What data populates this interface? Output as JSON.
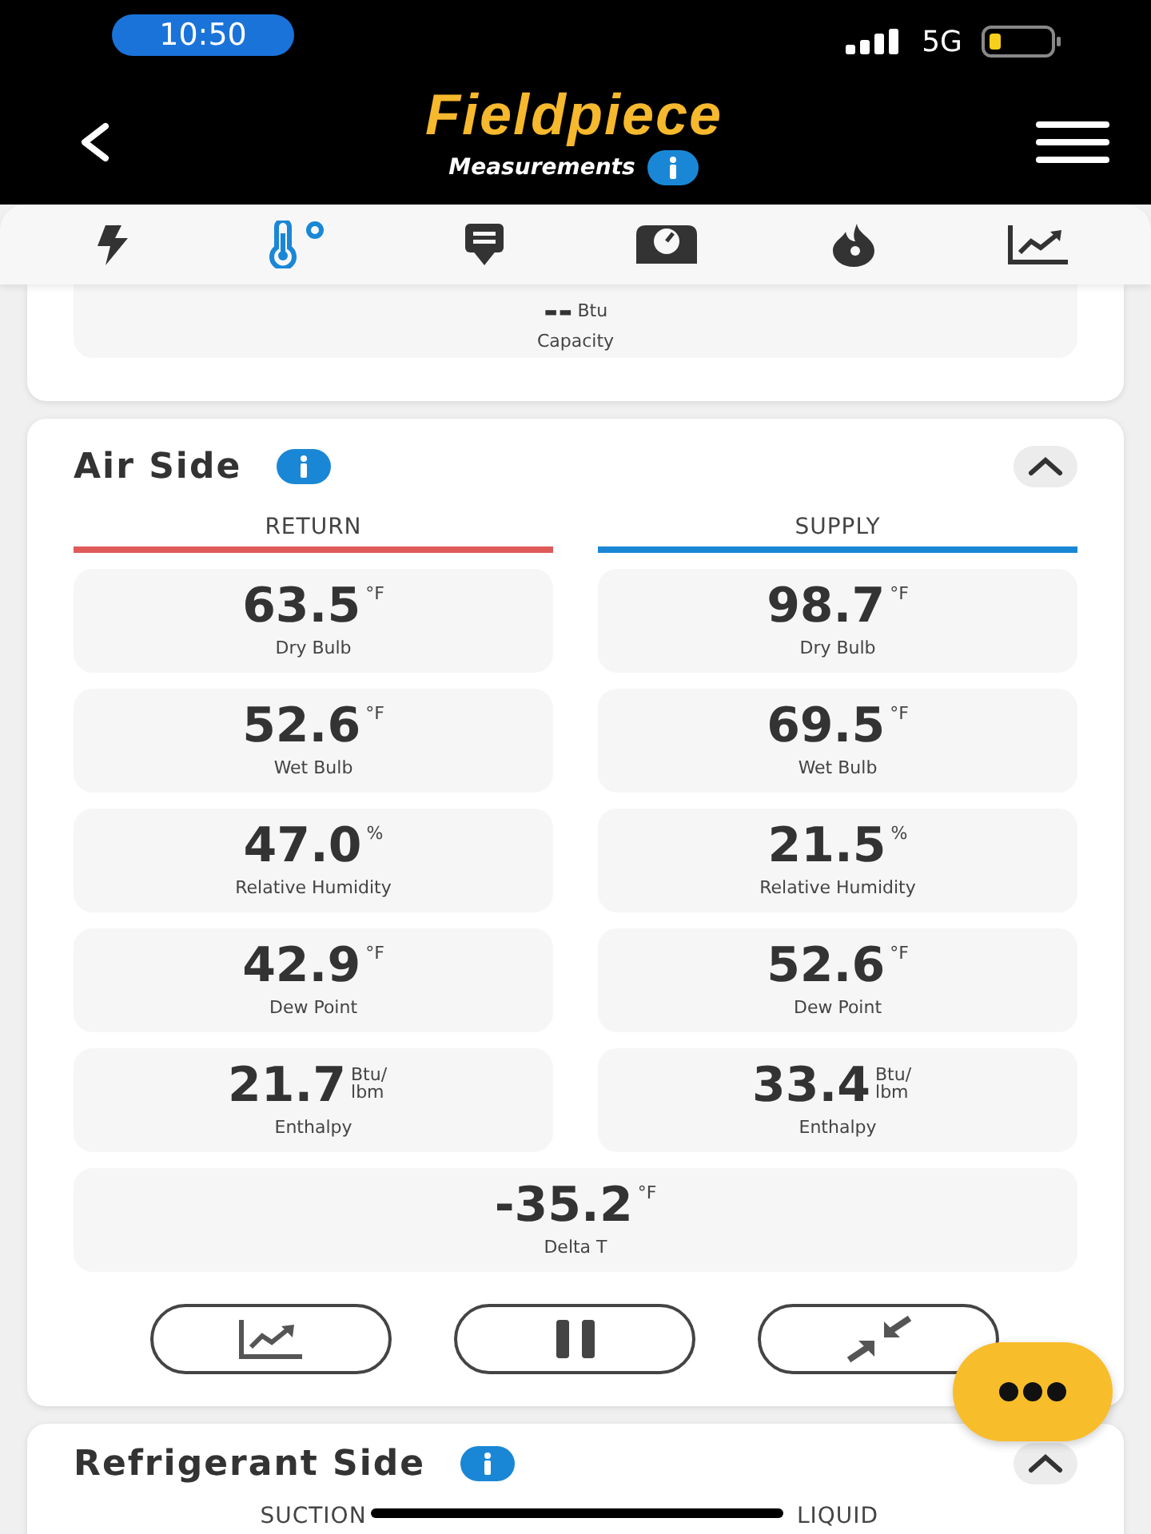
{
  "status_bar": {
    "time": "10:50",
    "network": "5G"
  },
  "header": {
    "title": "Fieldpiece",
    "subtitle": "Measurements"
  },
  "tabs": [
    {
      "kind": "power",
      "selected": false
    },
    {
      "kind": "temperature",
      "selected": true
    },
    {
      "kind": "download",
      "selected": false
    },
    {
      "kind": "scale",
      "selected": false
    },
    {
      "kind": "flame",
      "selected": false
    },
    {
      "kind": "chart",
      "selected": false
    }
  ],
  "capacity": {
    "value": "--",
    "unit": "Btu",
    "label": "Capacity"
  },
  "air_side": {
    "title": "Air Side",
    "expanded": true,
    "columns": [
      {
        "label": "RETURN",
        "color": "#e05a5a",
        "readings": [
          {
            "value": "63.5",
            "unit": "°F",
            "label": "Dry Bulb"
          },
          {
            "value": "52.6",
            "unit": "°F",
            "label": "Wet Bulb"
          },
          {
            "value": "47.0",
            "unit": "%",
            "label": "Relative Humidity"
          },
          {
            "value": "42.9",
            "unit": "°F",
            "label": "Dew Point"
          },
          {
            "value": "21.7",
            "unit": "Btu/ lbm",
            "label": "Enthalpy"
          }
        ]
      },
      {
        "label": "SUPPLY",
        "color": "#1a87d6",
        "readings": [
          {
            "value": "98.7",
            "unit": "°F",
            "label": "Dry Bulb"
          },
          {
            "value": "69.5",
            "unit": "°F",
            "label": "Wet Bulb"
          },
          {
            "value": "21.5",
            "unit": "%",
            "label": "Relative Humidity"
          },
          {
            "value": "52.6",
            "unit": "°F",
            "label": "Dew Point"
          },
          {
            "value": "33.4",
            "unit": "Btu/ lbm",
            "label": "Enthalpy"
          }
        ]
      }
    ],
    "delta": {
      "value": "-35.2",
      "unit": "°F",
      "label": "Delta T"
    },
    "buttons": [
      {
        "kind": "chart"
      },
      {
        "kind": "pause"
      },
      {
        "kind": "collapse"
      }
    ]
  },
  "refrigerant_side": {
    "title": "Refrigerant Side",
    "expanded": true,
    "columns": [
      {
        "label": "SUCTION"
      },
      {
        "label": "LIQUID"
      }
    ]
  }
}
